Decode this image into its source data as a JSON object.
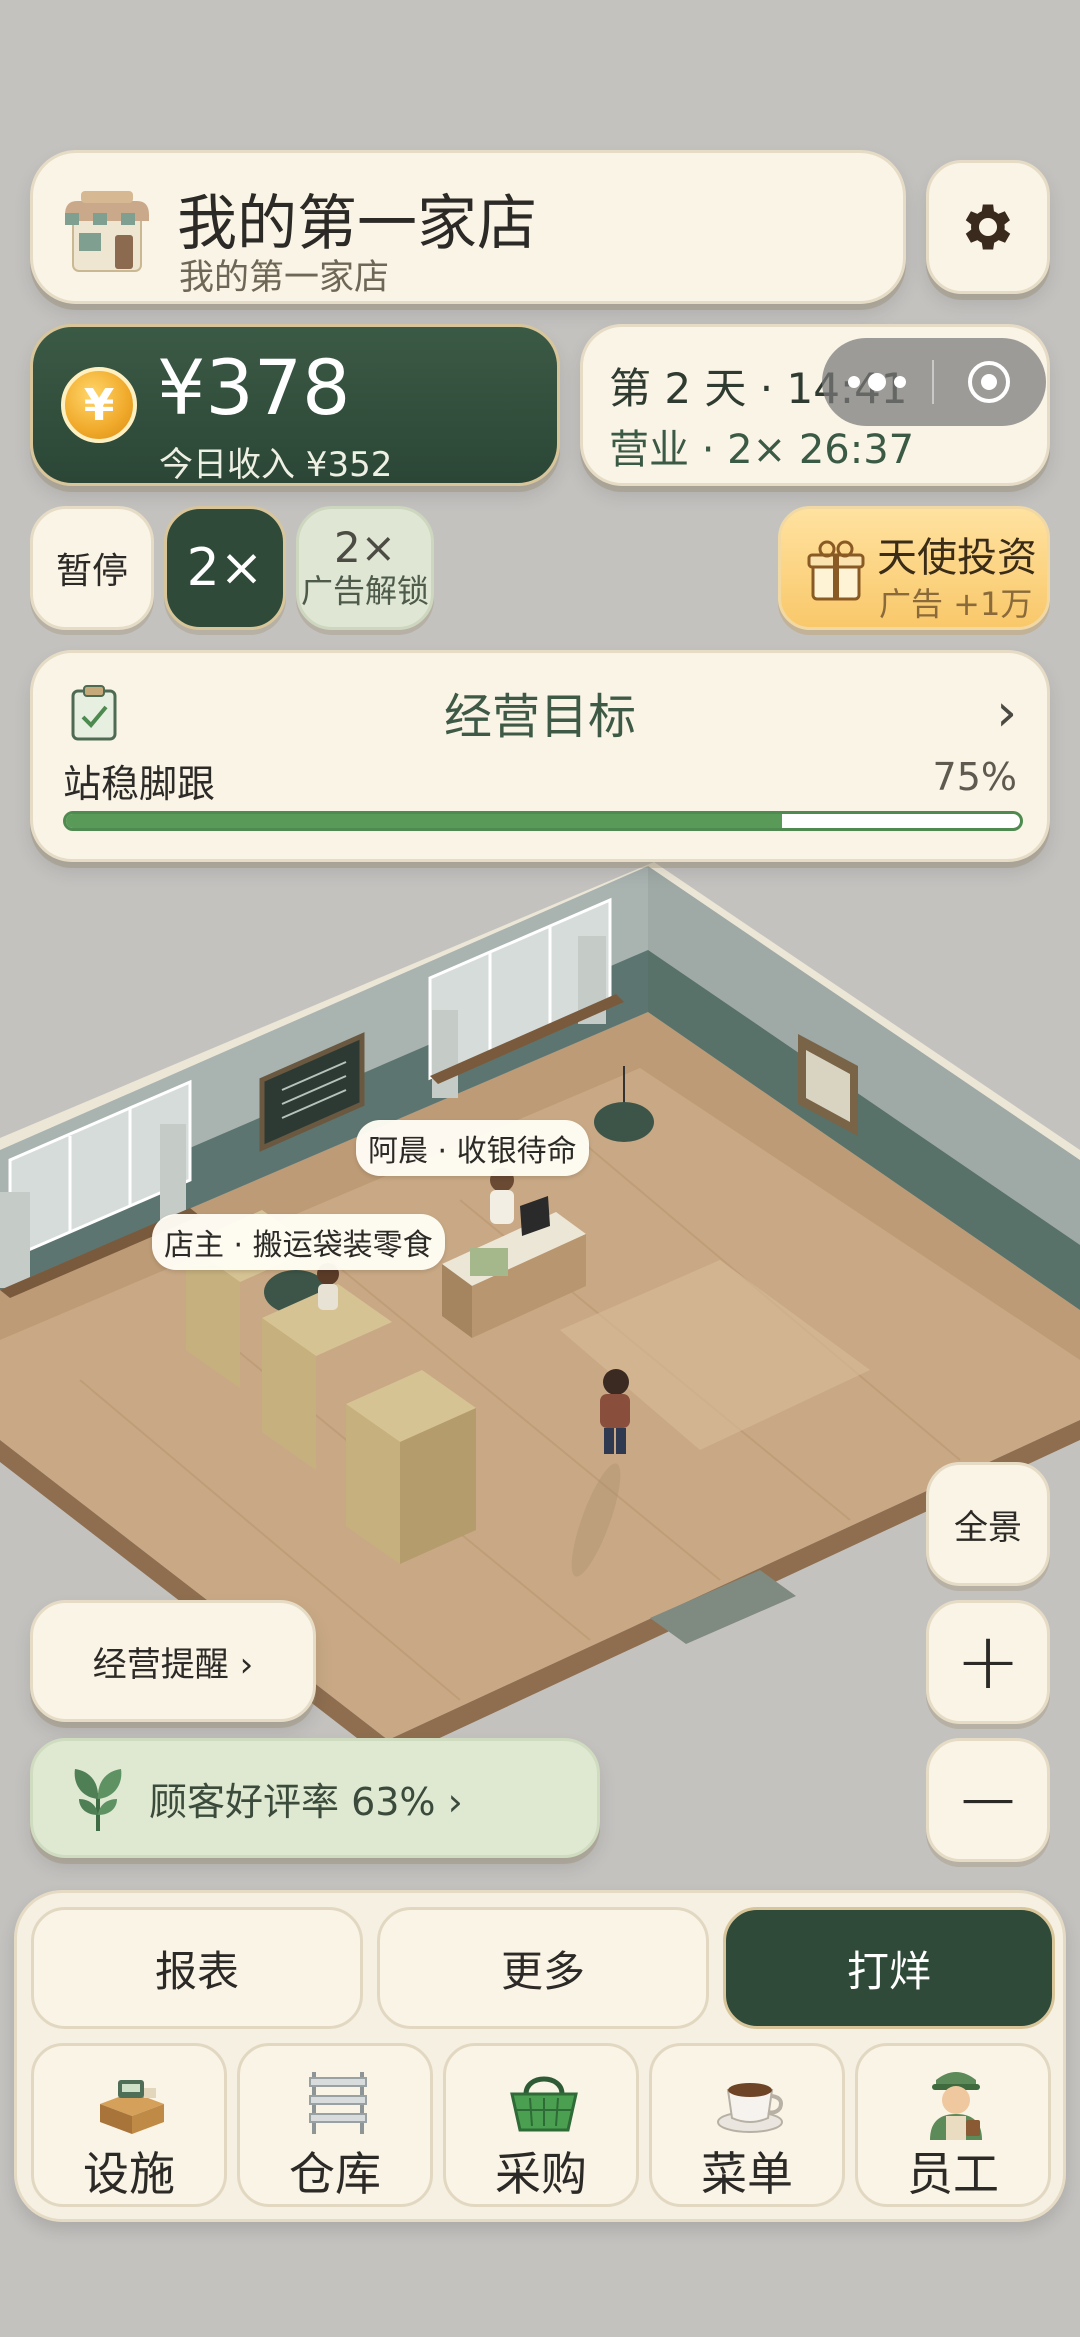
{
  "shop": {
    "title": "我的第一家店",
    "subtitle": "我的第一家店",
    "icon": "storefront-icon"
  },
  "settings": {
    "icon": "gear-icon"
  },
  "money": {
    "value": "¥378",
    "income_today": "今日收入 ¥352",
    "icon": "yuan-coin-icon",
    "coin_glyph": "¥"
  },
  "day": {
    "line1": "第 2 天 · 14:41",
    "line2": "营业 · 2× 26:37"
  },
  "speed": {
    "pause": "暂停",
    "current": "2×",
    "ad_speed": "2×",
    "ad_speed_sub": "广告解锁"
  },
  "angel": {
    "title": "天使投资",
    "subtitle": "广告 +1万",
    "icon": "gift-icon"
  },
  "goal": {
    "title": "经营目标",
    "arrow": "›",
    "name": "站稳脚跟",
    "percent_label": "75%",
    "progress": 0.75,
    "icon": "clipboard-check-icon"
  },
  "scene": {
    "cashier_tag": "阿晨 · 收银待命",
    "owner_tag": "店主 · 搬运袋装零食"
  },
  "map_controls": {
    "panorama": "全景",
    "zoom_in": "+",
    "zoom_out": "−"
  },
  "reminder": {
    "label": "经营提醒 ›"
  },
  "rating": {
    "label": "顾客好评率 63% ›",
    "icon": "leaf-sprout-icon"
  },
  "actions": {
    "report": "报表",
    "more": "更多",
    "close_shop": "打烊"
  },
  "nav": [
    {
      "label": "设施",
      "icon": "cash-register-icon"
    },
    {
      "label": "仓库",
      "icon": "shelf-icon"
    },
    {
      "label": "采购",
      "icon": "basket-icon"
    },
    {
      "label": "菜单",
      "icon": "coffee-cup-icon"
    },
    {
      "label": "员工",
      "icon": "staff-icon"
    }
  ],
  "colors": {
    "background": "#c4c2bf",
    "card": "#faf4e6",
    "primary_green": "#2f4a39",
    "accent_gold": "#f9c86a",
    "progress_green": "#5a9a58",
    "rating_green_bg": "#dfe8d1"
  }
}
